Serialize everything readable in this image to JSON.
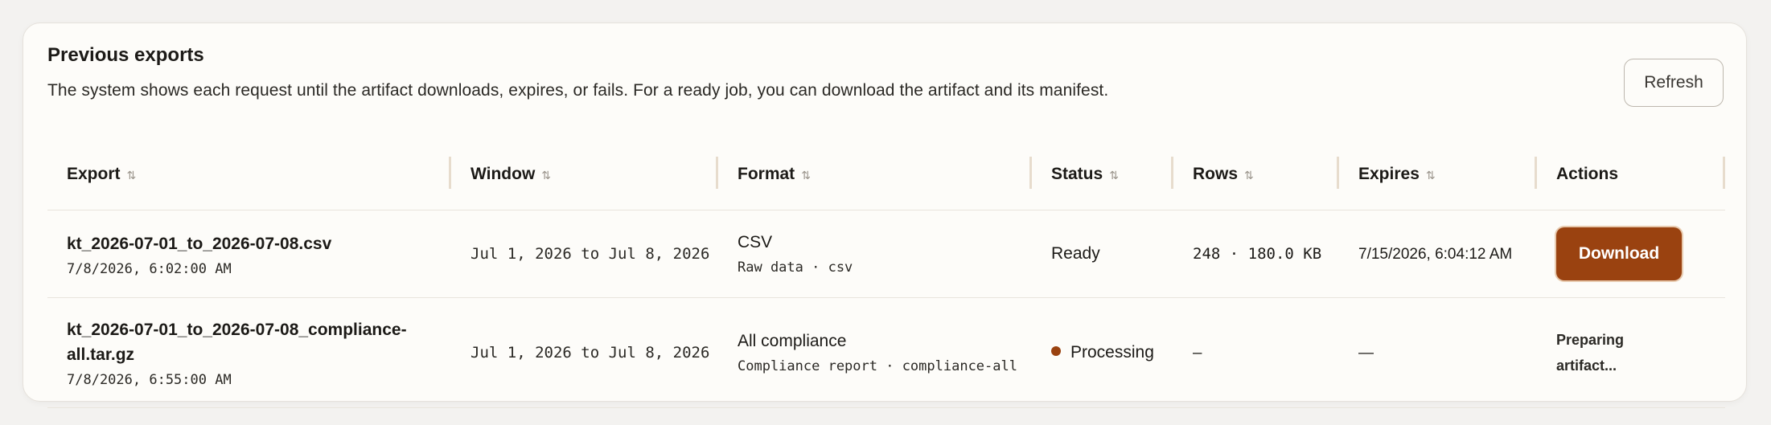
{
  "section": {
    "title": "Previous exports",
    "description": "The system shows each request until the artifact downloads, expires, or fails. For a ready job, you can download the artifact and its manifest.",
    "refresh_label": "Refresh"
  },
  "table": {
    "columns": [
      {
        "label": "Export",
        "sortable": true
      },
      {
        "label": "Window",
        "sortable": true
      },
      {
        "label": "Format",
        "sortable": true
      },
      {
        "label": "Status",
        "sortable": true
      },
      {
        "label": "Rows",
        "sortable": true
      },
      {
        "label": "Expires",
        "sortable": true
      },
      {
        "label": "Actions",
        "sortable": false
      }
    ],
    "sort_icon": "⇅",
    "rows": [
      {
        "filename": "kt_2026-07-01_to_2026-07-08.csv",
        "created": "7/8/2026, 6:02:00 AM",
        "window": "Jul 1, 2026 to Jul 8, 2026",
        "format_name": "CSV",
        "format_detail": "Raw data · csv",
        "status": "Ready",
        "rows": "248 · 180.0 KB",
        "expires": "7/15/2026, 6:04:12 AM",
        "action_label": "Download"
      },
      {
        "filename": "kt_2026-07-01_to_2026-07-08_compliance-all.tar.gz",
        "created": "7/8/2026, 6:55:00 AM",
        "window": "Jul 1, 2026 to Jul 8, 2026",
        "format_name": "All compliance",
        "format_detail": "Compliance report · compliance-all",
        "status": "Processing",
        "status_color": "#9a4210",
        "rows": "–",
        "expires": "—",
        "action_label": "Preparing artifact..."
      }
    ]
  },
  "colors": {
    "accent": "#9a4210",
    "card_bg": "#fdfcf9",
    "page_bg": "#f3f2f0"
  }
}
